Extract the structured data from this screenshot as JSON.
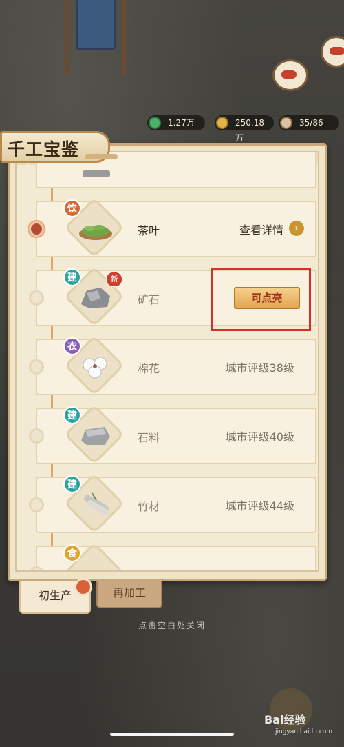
{
  "resources": [
    {
      "icon": "jade-coin-icon",
      "value": "1.27万"
    },
    {
      "icon": "gold-coin-icon",
      "value": "250.18万"
    },
    {
      "icon": "worker-icon",
      "value": "35/86"
    }
  ],
  "panel": {
    "title": "千工宝鉴",
    "items": [
      {
        "category": "饮",
        "name": "茶叶",
        "status": "查看详情",
        "state": "unlocked",
        "is_new": false
      },
      {
        "category": "建",
        "name": "矿石",
        "status": "可点亮",
        "state": "available",
        "is_new": true,
        "new_label": "新"
      },
      {
        "category": "衣",
        "name": "棉花",
        "status": "城市评级38级",
        "state": "locked",
        "is_new": false
      },
      {
        "category": "建",
        "name": "石料",
        "status": "城市评级40级",
        "state": "locked",
        "is_new": false
      },
      {
        "category": "建",
        "name": "竹材",
        "status": "城市评级44级",
        "state": "locked",
        "is_new": false
      },
      {
        "category": "食",
        "name": "",
        "status": "",
        "state": "locked",
        "is_new": false
      }
    ]
  },
  "tabs": [
    {
      "label": "初生产",
      "active": true
    },
    {
      "label": "再加工",
      "active": false
    }
  ],
  "hint": "点击空白处关闭",
  "watermark": {
    "brand": "Bai经验",
    "url": "jingyan.baidu.com"
  },
  "colors": {
    "highlight": "#dd2a2a",
    "accent_button": "#e2a653"
  }
}
